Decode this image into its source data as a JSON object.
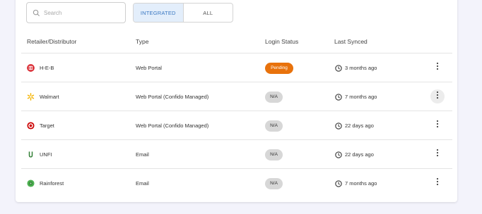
{
  "search": {
    "placeholder": "Search"
  },
  "filter_toggle": {
    "integrated_label": "INTEGRATED",
    "all_label": "ALL",
    "selected": "INTEGRATED"
  },
  "table": {
    "headers": {
      "retailer": "Retailer/Distributor",
      "type": "Type",
      "login_status": "Login Status",
      "last_synced": "Last Synced"
    },
    "rows": [
      {
        "name": "H-E-B",
        "logo": "heb-logo",
        "type": "Web Portal",
        "status": "Pending",
        "synced": "3 months ago"
      },
      {
        "name": "Walmart",
        "logo": "walmart-spark-logo",
        "type": "Web Portal (Confido Managed)",
        "status": "N/A",
        "synced": "7 months ago"
      },
      {
        "name": "Target",
        "logo": "target-bullseye-logo",
        "type": "Web Portal (Confido Managed)",
        "status": "N/A",
        "synced": "22 days ago"
      },
      {
        "name": "UNFI",
        "logo": "unfi-logo",
        "type": "Email",
        "status": "N/A",
        "synced": "22 days ago"
      },
      {
        "name": "Rainforest",
        "logo": "rainforest-logo",
        "type": "Email",
        "status": "N/A",
        "synced": "7 months ago"
      }
    ]
  },
  "colors": {
    "pending": "#e8720c",
    "na": "#d7d7d7",
    "active_toggle_bg": "#e3eefb",
    "active_toggle_text": "#3a78c2",
    "heb_red": "#d9262e",
    "walmart_yellow": "#f5b400",
    "target_red": "#cc0000",
    "unfi_green": "#2f7d32",
    "rainforest_green": "#4caf50"
  }
}
